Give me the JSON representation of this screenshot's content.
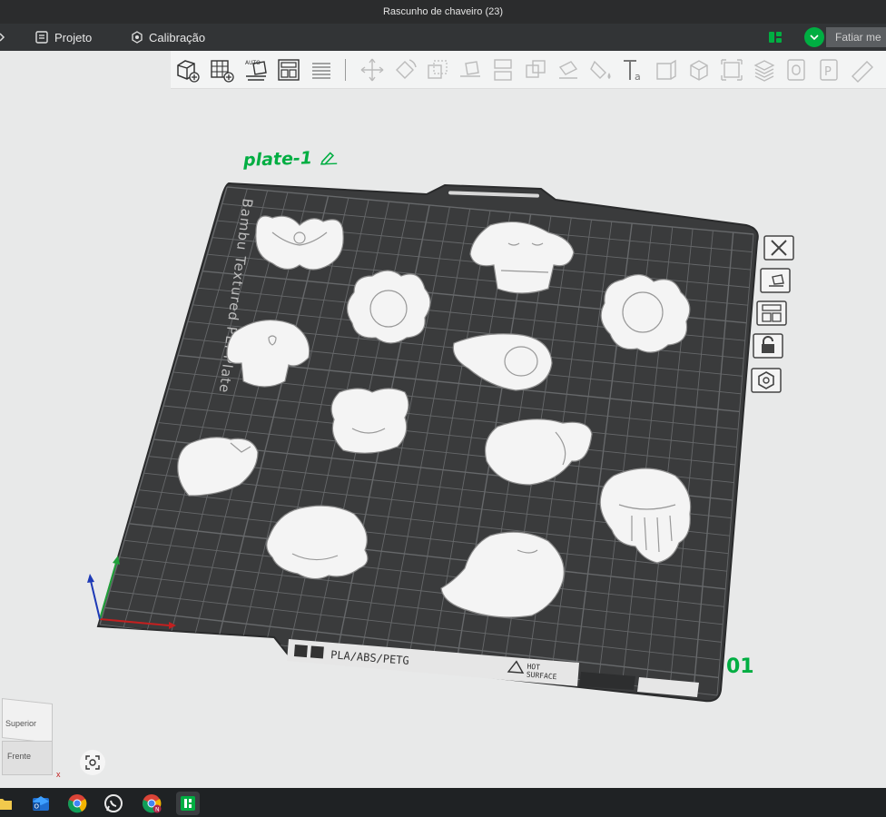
{
  "window": {
    "title": "Rascunho de chaveiro (23)"
  },
  "menu": {
    "items": [
      {
        "label": "Projeto",
        "icon": "project-icon"
      },
      {
        "label": "Calibração",
        "icon": "calibration-icon"
      }
    ],
    "slice_label": "Fatiar me"
  },
  "toolbar": {
    "icons": [
      "add-object-icon",
      "add-plate-icon",
      "auto-orient-icon",
      "arrange-icon",
      "split-layers-icon",
      "move-icon",
      "rotate-icon",
      "scale-icon",
      "lay-on-face-icon",
      "cut-icon",
      "boolean-icon",
      "support-paint-icon",
      "color-paint-icon",
      "text-tool-icon",
      "mesh-icon",
      "assembly-icon",
      "measure-icon",
      "variable-layer-icon",
      "part-icon",
      "p-icon",
      "ruler-icon"
    ]
  },
  "plate": {
    "label": "plate-1",
    "number": "01",
    "bed_text": "Bambu Textured PEI Plate",
    "material_text": "PLA/ABS/PETG",
    "warning_text_line1": "HOT",
    "warning_text_line2": "SURFACE"
  },
  "objects": [
    "butterfly",
    "cactus",
    "flower-left",
    "flower-right",
    "mushroom",
    "avocado",
    "frog",
    "fish",
    "strawberry",
    "jellyfish",
    "octopus",
    "dolphin"
  ],
  "side_icons": [
    "delete-icon",
    "auto-orient-plate-icon",
    "arrange-plate-icon",
    "lock-icon",
    "plate-settings-icon"
  ],
  "navcube": {
    "top_label": "Superior",
    "front_label": "Frente",
    "axis_label": "x"
  },
  "colors": {
    "accent": "#00ae42",
    "bed": "#3a3b3c",
    "grid": "#6a6b6d",
    "object": "#f4f4f4"
  }
}
